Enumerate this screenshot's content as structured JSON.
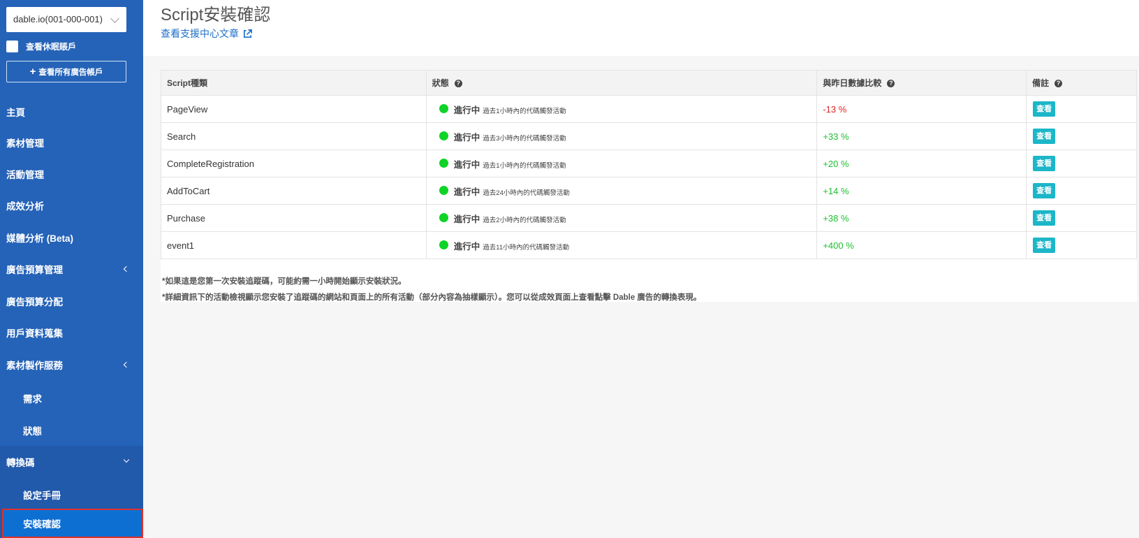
{
  "sidebar": {
    "account_select": "dable.io(001-000-001)",
    "dormant_label": "查看休眠賬戶",
    "all_accounts_label": "查看所有廣告帳戶",
    "items": [
      {
        "label": "主頁"
      },
      {
        "label": "素材管理"
      },
      {
        "label": "活動管理"
      },
      {
        "label": "成效分析"
      },
      {
        "label": "媒體分析 (Beta)"
      },
      {
        "label": "廣告預算管理"
      },
      {
        "label": "廣告預算分配"
      },
      {
        "label": "用戶資料蒐集"
      },
      {
        "label": "素材製作服務"
      },
      {
        "label": "需求"
      },
      {
        "label": "狀態"
      },
      {
        "label": "轉換碼"
      },
      {
        "label": "設定手冊"
      },
      {
        "label": "安裝確認"
      }
    ]
  },
  "header": {
    "title": "Script安裝確認",
    "help_link": "查看支援中心文章"
  },
  "table": {
    "columns": [
      "Script種類",
      "狀態",
      "與昨日數據比較",
      "備註"
    ],
    "help_mark": "?",
    "rows": [
      {
        "script": "PageView",
        "status": "進行中",
        "desc": "過去1小時內的代碼觸發活動",
        "change": "-13 %",
        "action": "查看"
      },
      {
        "script": "Search",
        "status": "進行中",
        "desc": "過去3小時內的代碼觸發活動",
        "change": "+33 %",
        "action": "查看"
      },
      {
        "script": "CompleteRegistration",
        "status": "進行中",
        "desc": "過去1小時內的代碼觸發活動",
        "change": "+20 %",
        "action": "查看"
      },
      {
        "script": "AddToCart",
        "status": "進行中",
        "desc": "過去24小時內的代碼觸發活動",
        "change": "+14 %",
        "action": "查看"
      },
      {
        "script": "Purchase",
        "status": "進行中",
        "desc": "過去2小時內的代碼觸發活動",
        "change": "+38 %",
        "action": "查看"
      },
      {
        "script": "event1",
        "status": "進行中",
        "desc": "過去11小時內的代碼觸發活動",
        "change": "+400 %",
        "action": "查看"
      }
    ]
  },
  "notes": [
    "*如果這是您第一次安裝追蹤碼，可能約需一小時開始顯示安裝狀況。",
    "*詳細資訊下的活動檢視顯示您安裝了追蹤碼的網站和頁面上的所有活動（部分內容為抽樣顯示）。您可以從成效頁面上查看點擊 Dable 廣告的轉換表現。"
  ],
  "colors": {
    "sidebar": "#2563b8",
    "active_item": "#0e6fd3",
    "highlight_border": "#e0312b",
    "positive": "#1cbf2e",
    "negative": "#e22424",
    "status_dot": "#0fd327",
    "view_button": "#1cb6c9",
    "link": "#1d6fc9"
  }
}
